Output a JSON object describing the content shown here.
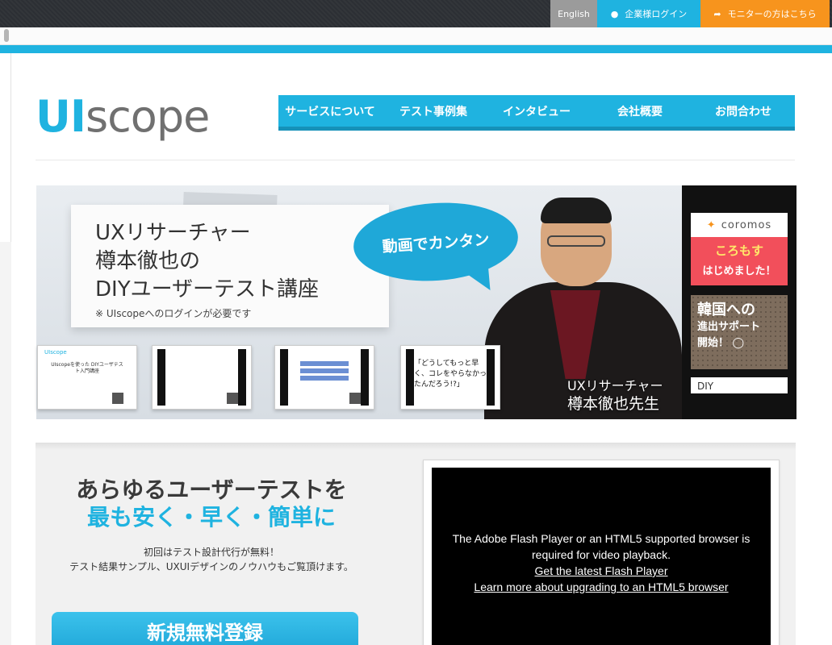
{
  "topbar": {
    "english": "English",
    "corporate_login": "企業様ログイン",
    "monitor": "モニターの方はこちら"
  },
  "logo": {
    "ui": "UI",
    "scope": "scope"
  },
  "nav": [
    "サービスについて",
    "テスト事例集",
    "インタビュー",
    "会社概要",
    "お問合わせ"
  ],
  "hero": {
    "title_line1": "UXリサーチャー",
    "title_line2": "樽本徹也の",
    "title_line3": "DIYユーザーテスト講座",
    "note": "※ UIscopeへのログインが必要です",
    "bubble": "動画でカンタン",
    "person_role": "UXリサーチャー",
    "person_name": "樽本徹也先生",
    "thumb1_brand": "UIscope",
    "thumb1_caption": "UIscopeを使った DIYユーザテスト入門講座",
    "thumb4_quote": "「どうしてもっと早く、コレをやらなかったんだろう!?」"
  },
  "side_ads": {
    "ad1_logo": "coromos",
    "ad1_title": "ころもす",
    "ad1_sub": "はじめました！",
    "ad2_line1": "韓国への",
    "ad2_line2": "進出サポート",
    "ad2_line3": "開始！",
    "ad3_text": "DIY"
  },
  "lower": {
    "headline1": "あらゆるユーザーテストを",
    "headline2": "最も安く・早く・簡単に",
    "sub1": "初回はテスト設計代行が無料！",
    "sub2": "テスト結果サンプル、UXUIデザインのノウハウもご覧頂けます。",
    "cta": "新規無料登録"
  },
  "video": {
    "line1": "The Adobe Flash Player or an HTML5 supported browser is",
    "line2": "required for video playback.",
    "link1": "Get the latest Flash Player",
    "link2": "Learn more about upgrading to an HTML5 browser"
  },
  "colors": {
    "brand_blue": "#1fb3e0",
    "orange": "#f7941d",
    "grey": "#9b9b9b",
    "coral": "#f24f5b"
  }
}
